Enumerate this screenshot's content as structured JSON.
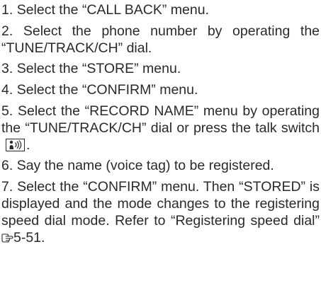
{
  "steps": [
    {
      "num": "1.",
      "before": "Select the “CALL BACK” menu."
    },
    {
      "num": "2.",
      "before": "Select the phone number by operating the “TUNE/TRACK/CH” dial."
    },
    {
      "num": "3.",
      "before": "Select the “STORE” menu."
    },
    {
      "num": "4.",
      "before": "Select the “CONFIRM” menu."
    },
    {
      "num": "5.",
      "before": "Select the “RECORD NAME” menu by operating the “TUNE/TRACK/CH” dial or press the talk switch",
      "after": "."
    },
    {
      "num": "6.",
      "before": "Say the name (voice tag) to be registered."
    },
    {
      "num": "7.",
      "before": "Select the “CONFIRM” menu. Then “STORED” is displayed and the mode changes to the registering speed dial mode. Refer to “Registering speed dial”",
      "ref_page": "5-51."
    }
  ],
  "icons": {
    "talk_switch": "talk-switch-icon",
    "page_reference": "page-reference-icon"
  }
}
